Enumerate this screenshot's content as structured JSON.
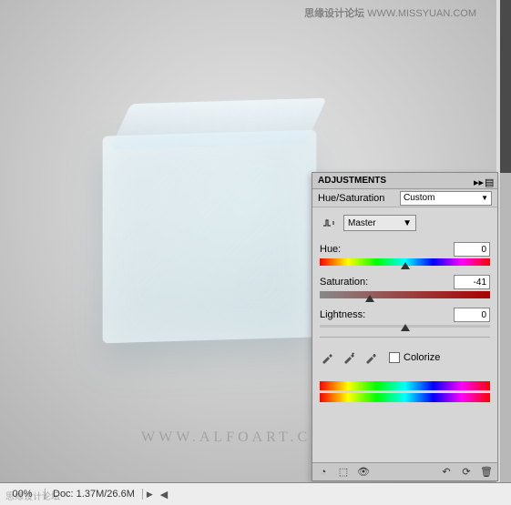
{
  "watermarks": {
    "top_cn": "思缘设计论坛",
    "top_url": "WWW.MISSYUAN.COM",
    "alfoart": "WWW.ALFOART.C",
    "bottom_cn": "思缘设计论坛"
  },
  "panel": {
    "title": "ADJUSTMENTS",
    "adjustment_name": "Hue/Saturation",
    "preset_label": "Custom",
    "master_label": "Master",
    "hue": {
      "label": "Hue:",
      "value": "0",
      "thumb_pct": 50
    },
    "saturation": {
      "label": "Saturation:",
      "value": "-41",
      "thumb_pct": 29.5
    },
    "lightness": {
      "label": "Lightness:",
      "value": "0",
      "thumb_pct": 50
    },
    "colorize_label": "Colorize",
    "colorize_checked": false
  },
  "status": {
    "zoom": "00%",
    "doc": "Doc: 1.37M/26.6M"
  },
  "icons": {
    "hand": "hand-icon",
    "dropper1": "eyedropper-icon",
    "dropper2": "eyedropper-plus-icon",
    "dropper3": "eyedropper-minus-icon",
    "collapse": "collapse-icon",
    "menu": "panel-menu-icon",
    "clip": "clip-icon",
    "preset": "preset-icon",
    "eye": "visibility-icon",
    "prev": "prev-state-icon",
    "reset": "reset-icon",
    "trash": "trash-icon"
  }
}
